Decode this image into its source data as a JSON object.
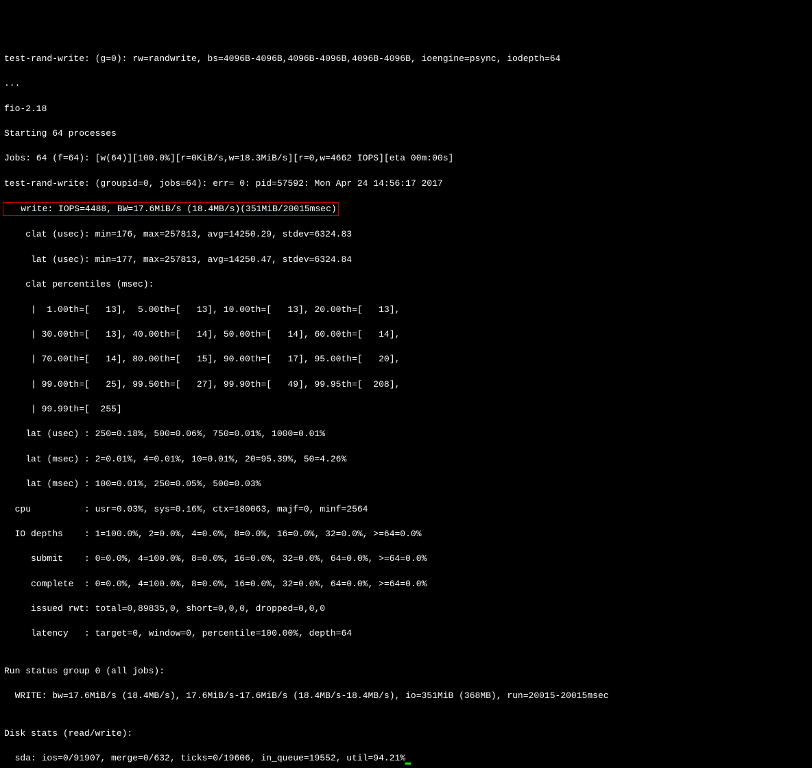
{
  "lines": {
    "l1": "test-rand-write: (g=0): rw=randwrite, bs=4096B-4096B,4096B-4096B,4096B-4096B, ioengine=psync, iodepth=64",
    "l2": "...",
    "l3": "fio-2.18",
    "l4": "Starting 64 processes",
    "l5": "Jobs: 64 (f=64): [w(64)][100.0%][r=0KiB/s,w=18.3MiB/s][r=0,w=4662 IOPS][eta 00m:00s]",
    "l6": "test-rand-write: (groupid=0, jobs=64): err= 0: pid=57592: Mon Apr 24 14:56:17 2017",
    "l7": "   write: IOPS=4488, BW=17.6MiB/s (18.4MB/s)(351MiB/20015msec)",
    "l8": "    clat (usec): min=176, max=257813, avg=14250.29, stdev=6324.83",
    "l9": "     lat (usec): min=177, max=257813, avg=14250.47, stdev=6324.84",
    "l10": "    clat percentiles (msec):",
    "l11": "     |  1.00th=[   13],  5.00th=[   13], 10.00th=[   13], 20.00th=[   13],",
    "l12": "     | 30.00th=[   13], 40.00th=[   14], 50.00th=[   14], 60.00th=[   14],",
    "l13": "     | 70.00th=[   14], 80.00th=[   15], 90.00th=[   17], 95.00th=[   20],",
    "l14": "     | 99.00th=[   25], 99.50th=[   27], 99.90th=[   49], 99.95th=[  208],",
    "l15": "     | 99.99th=[  255]",
    "l16": "    lat (usec) : 250=0.18%, 500=0.06%, 750=0.01%, 1000=0.01%",
    "l17": "    lat (msec) : 2=0.01%, 4=0.01%, 10=0.01%, 20=95.39%, 50=4.26%",
    "l18": "    lat (msec) : 100=0.01%, 250=0.05%, 500=0.03%",
    "l19": "  cpu          : usr=0.03%, sys=0.16%, ctx=180063, majf=0, minf=2564",
    "l20": "  IO depths    : 1=100.0%, 2=0.0%, 4=0.0%, 8=0.0%, 16=0.0%, 32=0.0%, >=64=0.0%",
    "l21": "     submit    : 0=0.0%, 4=100.0%, 8=0.0%, 16=0.0%, 32=0.0%, 64=0.0%, >=64=0.0%",
    "l22": "     complete  : 0=0.0%, 4=100.0%, 8=0.0%, 16=0.0%, 32=0.0%, 64=0.0%, >=64=0.0%",
    "l23": "     issued rwt: total=0,89835,0, short=0,0,0, dropped=0,0,0",
    "l24": "     latency   : target=0, window=0, percentile=100.00%, depth=64",
    "l25": "",
    "l26": "Run status group 0 (all jobs):",
    "l27": "  WRITE: bw=17.6MiB/s (18.4MB/s), 17.6MiB/s-17.6MiB/s (18.4MB/s-18.4MB/s), io=351MiB (368MB), run=20015-20015msec",
    "l28": "",
    "l29": "Disk stats (read/write):",
    "l30": "  sda: ios=0/91907, merge=0/632, ticks=0/19606, in_queue=19552, util=94.21%"
  }
}
